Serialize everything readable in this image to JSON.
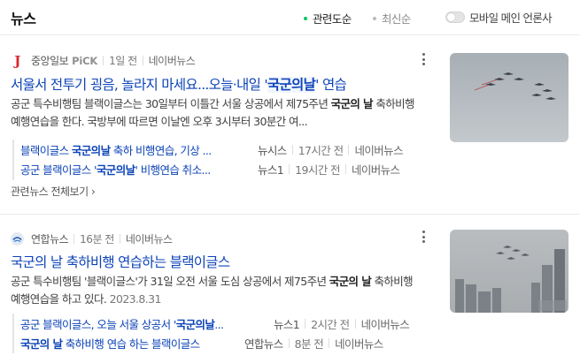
{
  "header": {
    "title": "뉴스",
    "sort_relevance": "관련도순",
    "sort_latest": "최신순",
    "mobile_main_toggle": "모바일 메인 언론사"
  },
  "colors": {
    "link": "#0c43b7",
    "active_dot": "#03c75a",
    "inactive_dot": "#bbbbbb",
    "joongang_logo": "#d7282f"
  },
  "news": [
    {
      "press": "중앙일보",
      "press_badge": "PiCK",
      "press_logo_icon": "joongang-logo-icon",
      "time": "1일 전",
      "portal": "네이버뉴스",
      "headline_pre": "서울서 전투기 굉음, 놀라지 마세요...오늘·내일 '",
      "headline_em": "국군의날",
      "headline_post": "' 연습",
      "summary_pre": "공군 특수비행팀 블랙이글스는 30일부터 이틀간 서울 상공에서 제75주년 ",
      "summary_em": "국군의 날",
      "summary_post": " 축하비행 예행연습을 한다. 국방부에 따르면 이날엔 오후 3시부터 30분간 여...",
      "summary_date": "",
      "related": [
        {
          "title_pre": "블랙이글스 ",
          "title_em": "국군의날",
          "title_post": " 축하 비행연습, 기상 ...",
          "press": "뉴시스",
          "time": "17시간 전",
          "portal": "네이버뉴스"
        },
        {
          "title_pre": "공군 블랙이글스 '",
          "title_em": "국군의날",
          "title_post": "' 비행연습 취소...",
          "press": "뉴스1",
          "time": "19시간 전",
          "portal": "네이버뉴스"
        }
      ],
      "all_news_label": "관련뉴스 전체보기"
    },
    {
      "press": "연합뉴스",
      "press_badge": "",
      "press_logo_icon": "yonhap-logo-icon",
      "time": "16분 전",
      "portal": "네이버뉴스",
      "headline_pre": "",
      "headline_em": "국군의 날",
      "headline_post": " 축하비행 연습하는 블랙이글스",
      "summary_pre": "공군 특수비행팀 '블랙이글스'가 31일 오전 서울 도심 상공에서 제75주년 ",
      "summary_em": "국군의 날",
      "summary_post": " 축하비행 예행연습을 하고 있다. ",
      "summary_date": "2023.8.31",
      "related": [
        {
          "title_pre": "공군 블랙이글스, 오늘 서울 상공서 '",
          "title_em": "국군의날",
          "title_post": "...",
          "press": "뉴스1",
          "time": "2시간 전",
          "portal": "네이버뉴스"
        },
        {
          "title_pre": "",
          "title_em": "국군의 날",
          "title_post": " 축하비행 연습 하는 블랙이글스",
          "press": "연합뉴스",
          "time": "8분 전",
          "portal": "네이버뉴스"
        }
      ],
      "all_news_label": ""
    }
  ]
}
